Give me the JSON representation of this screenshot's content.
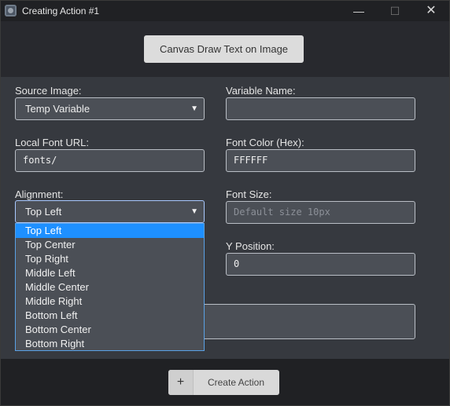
{
  "window": {
    "title": "Creating Action #1",
    "controls": {
      "minimize": "—",
      "maximize": "☐",
      "close": "✕"
    }
  },
  "header": {
    "action_button": "Canvas Draw Text on Image"
  },
  "form": {
    "source_image": {
      "label": "Source Image:",
      "value": "Temp Variable"
    },
    "variable_name": {
      "label": "Variable Name:",
      "value": ""
    },
    "local_font_url": {
      "label": "Local Font URL:",
      "value": "fonts/"
    },
    "font_color": {
      "label": "Font Color (Hex):",
      "value": "FFFFFF"
    },
    "alignment": {
      "label": "Alignment:",
      "value": "Top Left",
      "options": [
        "Top Left",
        "Top Center",
        "Top Right",
        "Middle Left",
        "Middle Center",
        "Middle Right",
        "Bottom Left",
        "Bottom Center",
        "Bottom Right"
      ],
      "selected_index": 0
    },
    "font_size": {
      "label": "Font Size:",
      "placeholder": "Default size 10px"
    },
    "y_position": {
      "label": "Y Position:",
      "value": "0"
    }
  },
  "footer": {
    "create_button": "Create Action",
    "create_icon": "plus-icon"
  },
  "colors": {
    "selected_option": "#1e90ff",
    "field_bg": "#4b4f56",
    "panel_bg": "#36393f"
  }
}
